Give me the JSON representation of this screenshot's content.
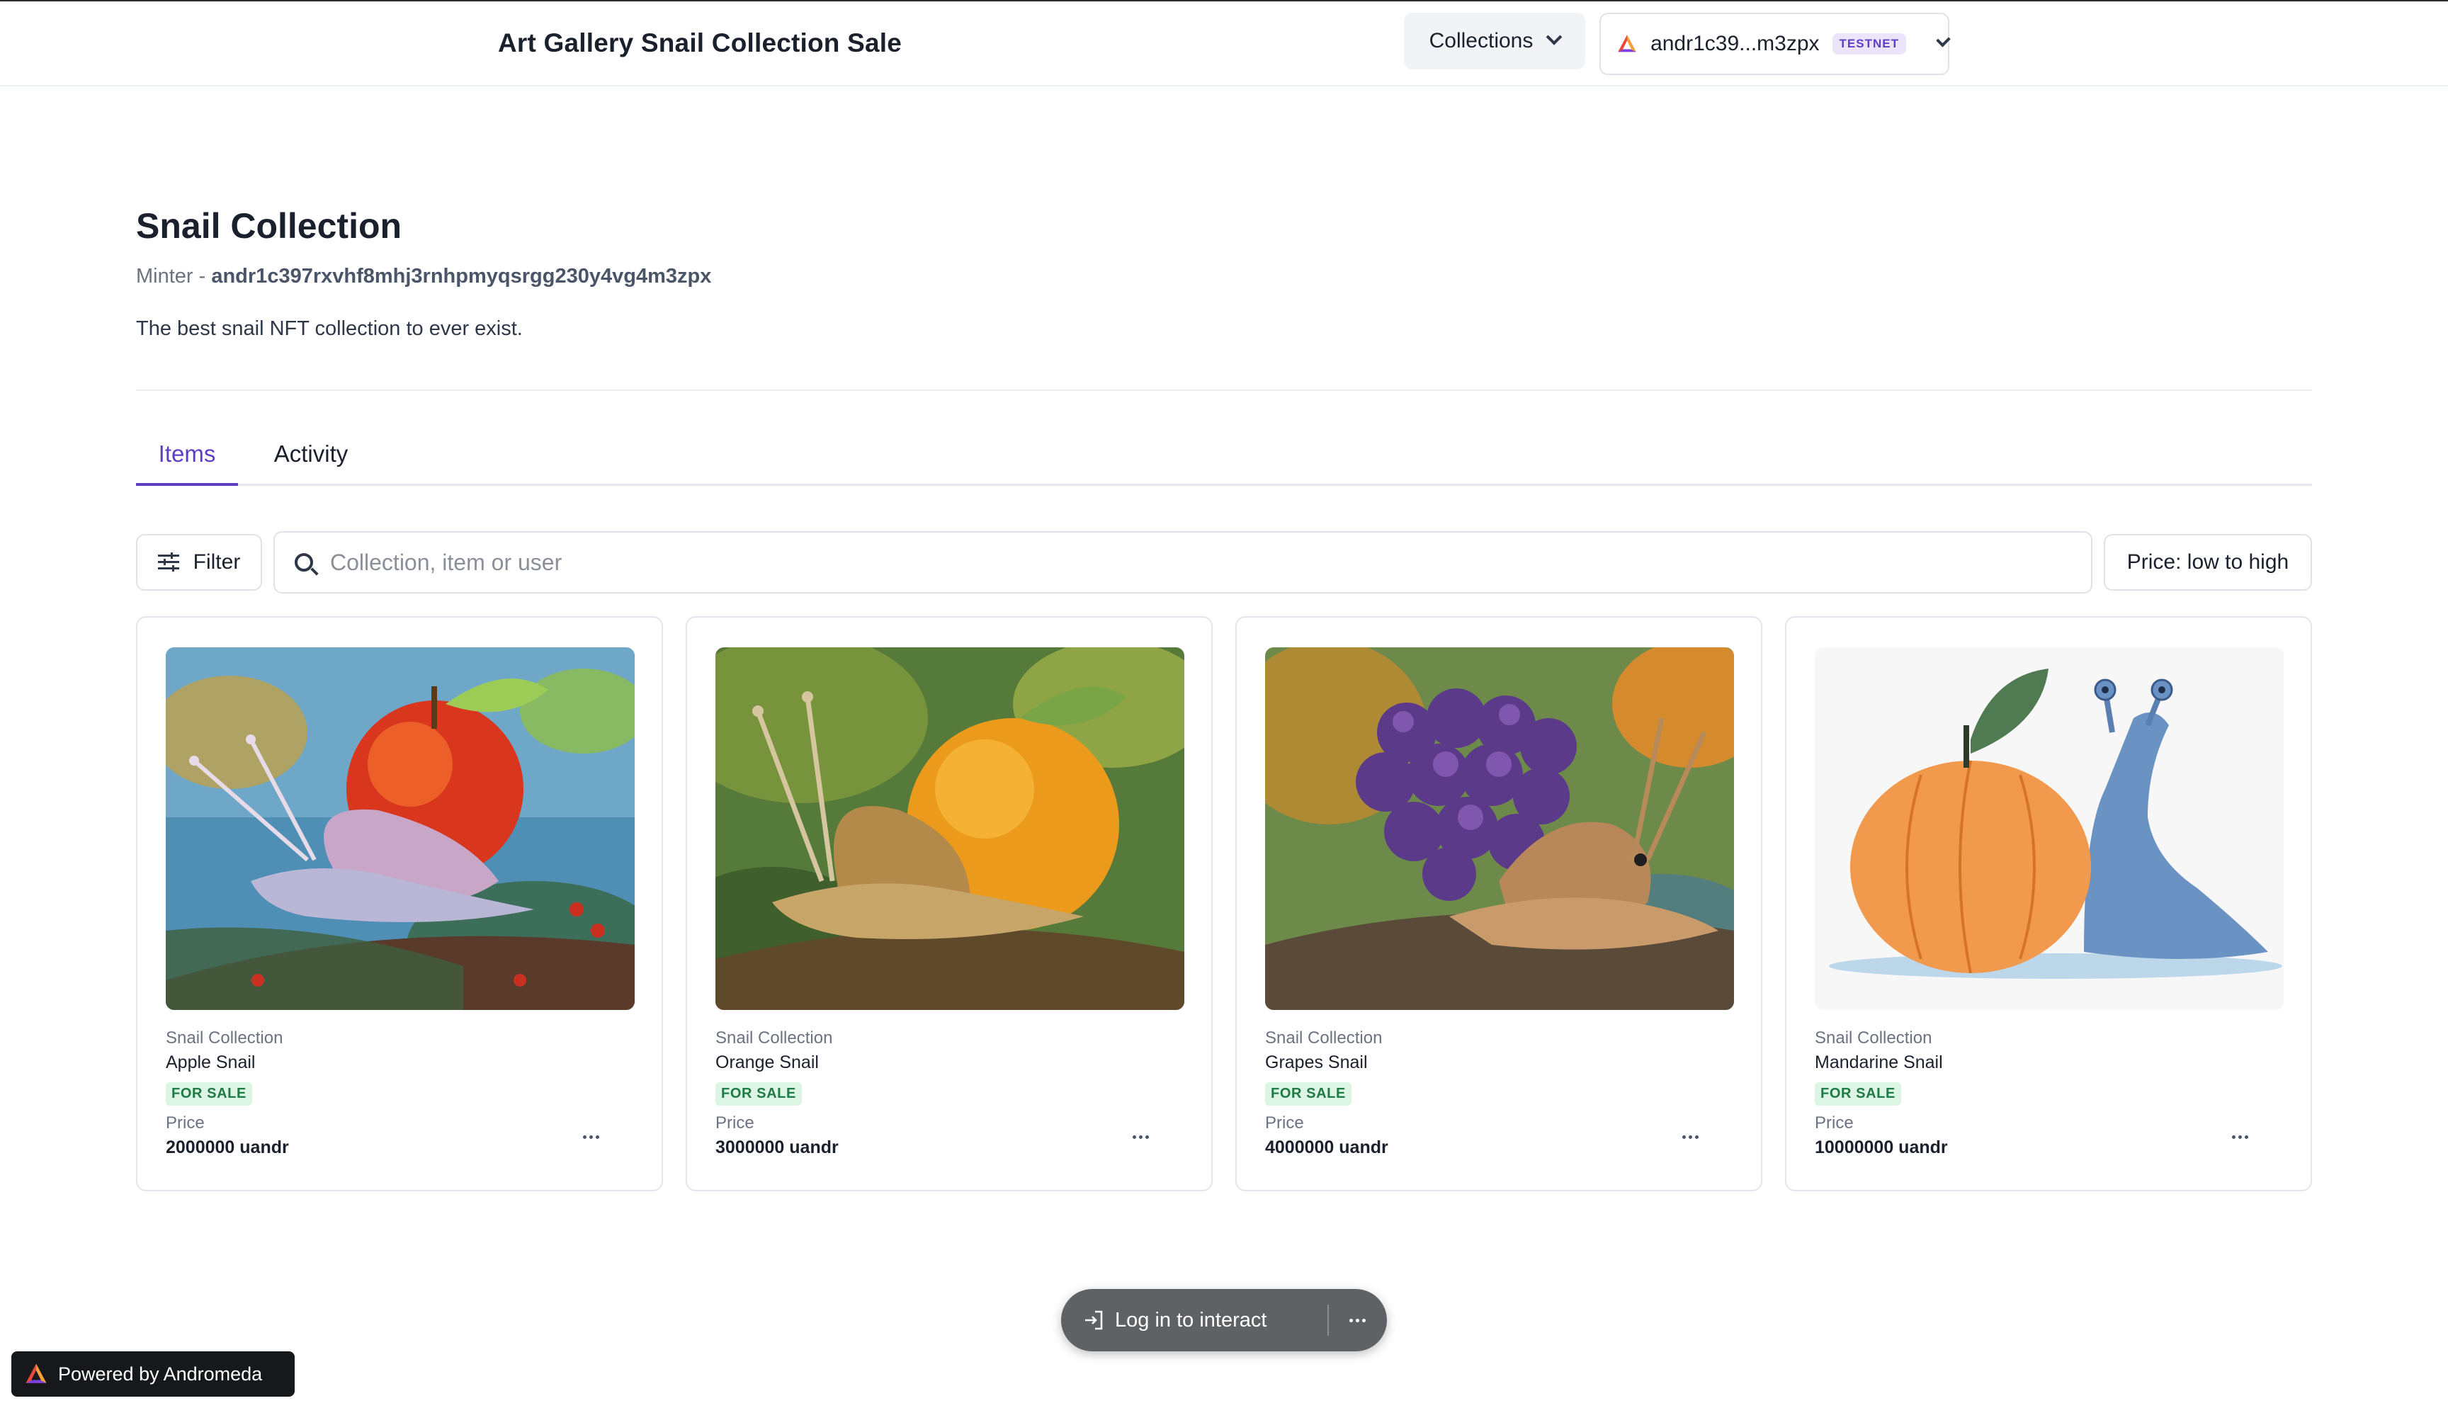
{
  "header": {
    "title": "Art Gallery Snail Collection Sale",
    "collections_label": "Collections",
    "wallet_address": "andr1c39...m3zpx",
    "network_badge": "TESTNET",
    "logo_icon": "andromeda-logo-icon"
  },
  "collection": {
    "title": "Snail Collection",
    "minter_label": "Minter - ",
    "minter_address": "andr1c397rxvhf8mhj3rnhpmyqsrgg230y4vg4m3zpx",
    "description": "The best snail NFT collection to ever exist."
  },
  "tabs": [
    {
      "label": "Items",
      "active": true
    },
    {
      "label": "Activity",
      "active": false
    }
  ],
  "toolbar": {
    "filter_label": "Filter",
    "search_placeholder": "Collection, item or user",
    "sort_label": "Price: low to high"
  },
  "items": [
    {
      "collection": "Snail Collection",
      "name": "Apple Snail",
      "status": "FOR SALE",
      "price_label": "Price",
      "price": "2000000 uandr"
    },
    {
      "collection": "Snail Collection",
      "name": "Orange Snail",
      "status": "FOR SALE",
      "price_label": "Price",
      "price": "3000000 uandr"
    },
    {
      "collection": "Snail Collection",
      "name": "Grapes Snail",
      "status": "FOR SALE",
      "price_label": "Price",
      "price": "4000000 uandr"
    },
    {
      "collection": "Snail Collection",
      "name": "Mandarine Snail",
      "status": "FOR SALE",
      "price_label": "Price",
      "price": "10000000 uandr"
    }
  ],
  "footer": {
    "login_label": "Log in to interact",
    "powered_by": "Powered by Andromeda"
  },
  "colors": {
    "accent": "#5b3fc4",
    "for_sale_bg": "#dcf5e4",
    "for_sale_text": "#1f7a45"
  }
}
